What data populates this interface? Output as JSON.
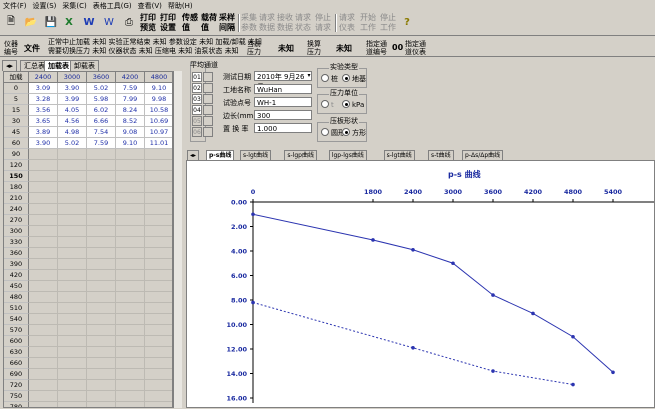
{
  "menu": [
    "文件(F)",
    "设置(S)",
    "采集(C)",
    "表格工具(G)",
    "查看(V)",
    "帮助(H)"
  ],
  "toolbar": {
    "print_preview": "打印\n预览",
    "print_settings": "打印\n设置",
    "sensor_value": "传感\n值",
    "load_unload": "载荷\n值",
    "sample_interval": "采样\n间隔",
    "disabled": [
      "采集\n参数",
      "请求\n数据",
      "接收\n数据",
      "请求\n状态",
      "停止\n请求",
      "请求\n仪表",
      "开始\n工作",
      "停止\n工作"
    ]
  },
  "status": {
    "meter_id_label": "仪器\n编号",
    "file_label": "文件",
    "state_lines": [
      "正常中止加载 未知 实验正常结束 未知 参数设定 未知 加载/卸载 未知",
      "需要切换压力 未知 仪器状态 未知 压缩电 未知 油泵状态 未知"
    ],
    "plate_label": "当前\n压力",
    "plate_value": "未知",
    "compress_label": "换算\n压力",
    "compress_value": "未知",
    "channel_label": "指定通\n道编号",
    "channel_value": "00",
    "meter_label": "指定通\n道仪表"
  },
  "left_tabs": [
    "汇总表",
    "加载表",
    "卸载表"
  ],
  "grid": {
    "corner": "加载",
    "columns": [
      "2400",
      "3000",
      "3600",
      "4200",
      "4800"
    ],
    "rows": [
      {
        "h": "0",
        "v": [
          "3.09",
          "3.90",
          "5.02",
          "7.59",
          "9.10"
        ]
      },
      {
        "h": "5",
        "v": [
          "3.28",
          "3.99",
          "5.98",
          "7.99",
          "9.98"
        ]
      },
      {
        "h": "15",
        "v": [
          "3.56",
          "4.05",
          "6.02",
          "8.24",
          "10.58"
        ]
      },
      {
        "h": "30",
        "v": [
          "3.65",
          "4.56",
          "6.66",
          "8.52",
          "10.69"
        ]
      },
      {
        "h": "45",
        "v": [
          "3.89",
          "4.98",
          "7.54",
          "9.08",
          "10.97"
        ]
      },
      {
        "h": "60",
        "v": [
          "3.90",
          "5.02",
          "7.59",
          "9.10",
          "11.01"
        ]
      }
    ],
    "empty_rows": [
      "90",
      "120",
      "150",
      "180",
      "210",
      "240",
      "270",
      "300",
      "330",
      "360",
      "390",
      "420",
      "450",
      "480",
      "510",
      "540",
      "570",
      "600",
      "630",
      "660",
      "690",
      "720",
      "750",
      "780"
    ]
  },
  "form": {
    "channel_title": "平均通道",
    "channels": [
      "01",
      "02",
      "03",
      "04",
      "05",
      "06"
    ],
    "test_date_label": "测试日期",
    "test_date_value": "2010年 9月26日",
    "project_label": "工地名称",
    "project_value": "WuHan",
    "point_label": "试验点号",
    "point_value": "WH-1",
    "edge_label": "边长(mm)",
    "edge_value": "300",
    "factor_label": "置 换 率",
    "factor_value": "1.000",
    "test_type_title": "实验类型",
    "test_type_options": [
      "桩",
      "地基"
    ],
    "test_type_selected": "地基",
    "pressure_unit_title": "压力单位",
    "pressure_unit_options": [
      "t",
      "kPa"
    ],
    "pressure_unit_selected": "kPa",
    "plate_shape_title": "压板形状",
    "plate_shape_options": [
      "圆形",
      "方形"
    ],
    "plate_shape_selected": "方形"
  },
  "chart_tabs": [
    "p-s曲线",
    "s-lgt曲线",
    "s-lgp曲线",
    "lgp-lgs曲线",
    "s-lgt曲线",
    "s-t曲线",
    "p-Δs/Δp曲线"
  ],
  "chart_data": {
    "type": "line",
    "title": "p-s 曲线",
    "x": [
      0,
      1800,
      2400,
      3000,
      3600,
      4200,
      4800,
      5400
    ],
    "xlim": [
      0,
      6000
    ],
    "ylim": [
      0,
      16
    ],
    "y_ticks": [
      "0.00",
      "2.00",
      "4.00",
      "6.00",
      "8.00",
      "10.00",
      "12.00",
      "14.00",
      "16.00"
    ],
    "series": [
      {
        "values": [
          1.0,
          3.1,
          3.9,
          5.0,
          7.6,
          9.1,
          11.0,
          13.9
        ],
        "style": "solid"
      },
      {
        "values": [
          8.2,
          null,
          11.9,
          null,
          13.8,
          null,
          14.9,
          null
        ],
        "style": "dotted"
      }
    ],
    "colors": {
      "line": "#2b34b0",
      "axis": "#1a2aa0"
    }
  }
}
